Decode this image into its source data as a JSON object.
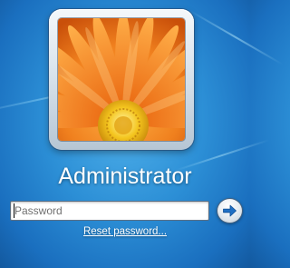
{
  "user": {
    "name": "Administrator",
    "avatar_icon": "orange-gerbera-flower"
  },
  "password": {
    "placeholder": "Password",
    "value": ""
  },
  "submit": {
    "icon": "arrow-right-icon"
  },
  "links": {
    "reset": "Reset password..."
  },
  "colors": {
    "background": "#2c8fd6",
    "flower_petal": "#f07a18",
    "flower_center": "#f5c928",
    "text": "#ffffff",
    "button_arrow": "#1f6fc4"
  }
}
